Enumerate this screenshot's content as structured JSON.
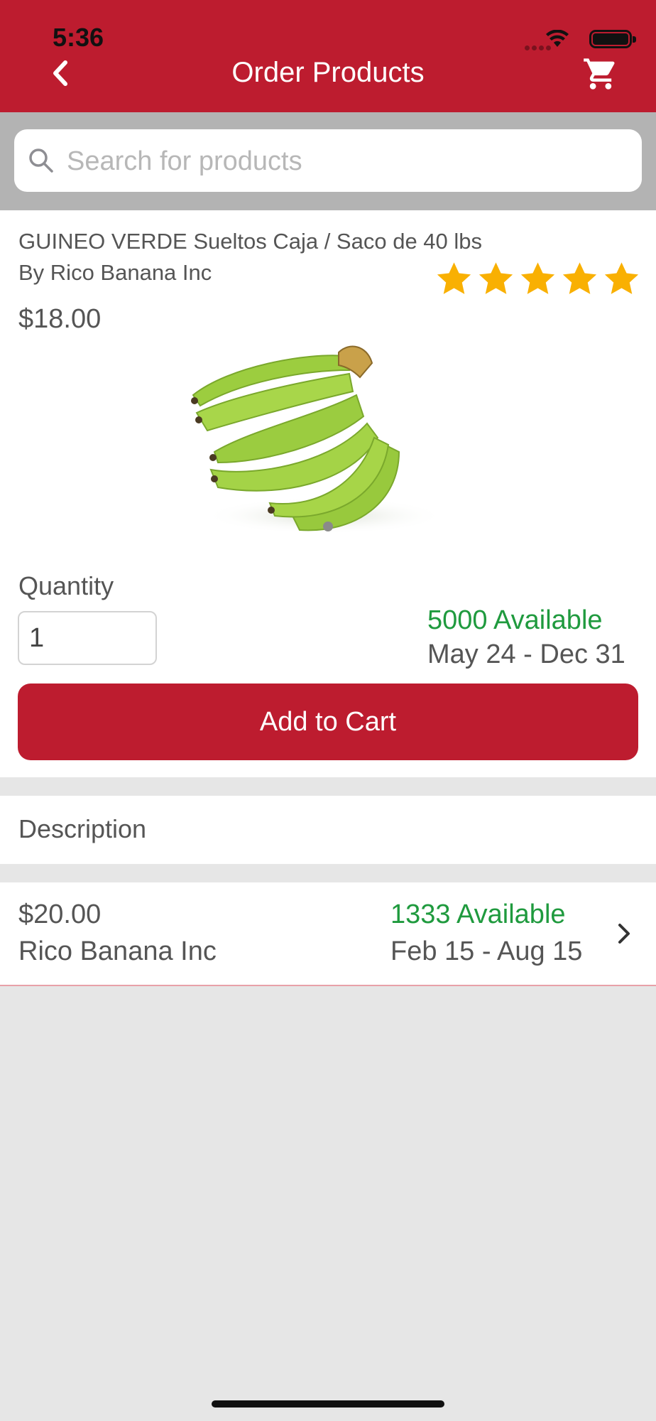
{
  "status_bar": {
    "time": "5:36"
  },
  "header": {
    "title": "Order Products",
    "back_icon": "chevron-left-icon",
    "cart_icon": "cart-icon"
  },
  "search": {
    "placeholder": "Search for products",
    "value": ""
  },
  "product": {
    "name": "GUINEO VERDE Sueltos Caja / Saco de 40 lbs",
    "seller": "By Rico Banana Inc",
    "rating": 5,
    "rating_max": 5,
    "price": "$18.00",
    "image_icon": "green-banana-bunch",
    "quantity_label": "Quantity",
    "quantity_value": "1",
    "available": "5000 Available",
    "date_range": "May 24 - Dec 31",
    "add_to_cart_label": "Add to Cart"
  },
  "description": {
    "label": "Description"
  },
  "offers": [
    {
      "price": "$20.00",
      "seller": "Rico Banana Inc",
      "available": "1333 Available",
      "date_range": "Feb 15 - Aug 15"
    }
  ],
  "colors": {
    "brand_red": "#bd1c2f",
    "available_green": "#1f9a3e",
    "star_gold": "#f9b002",
    "page_background": "#e6e6e6",
    "search_band": "#b3b3b3"
  }
}
